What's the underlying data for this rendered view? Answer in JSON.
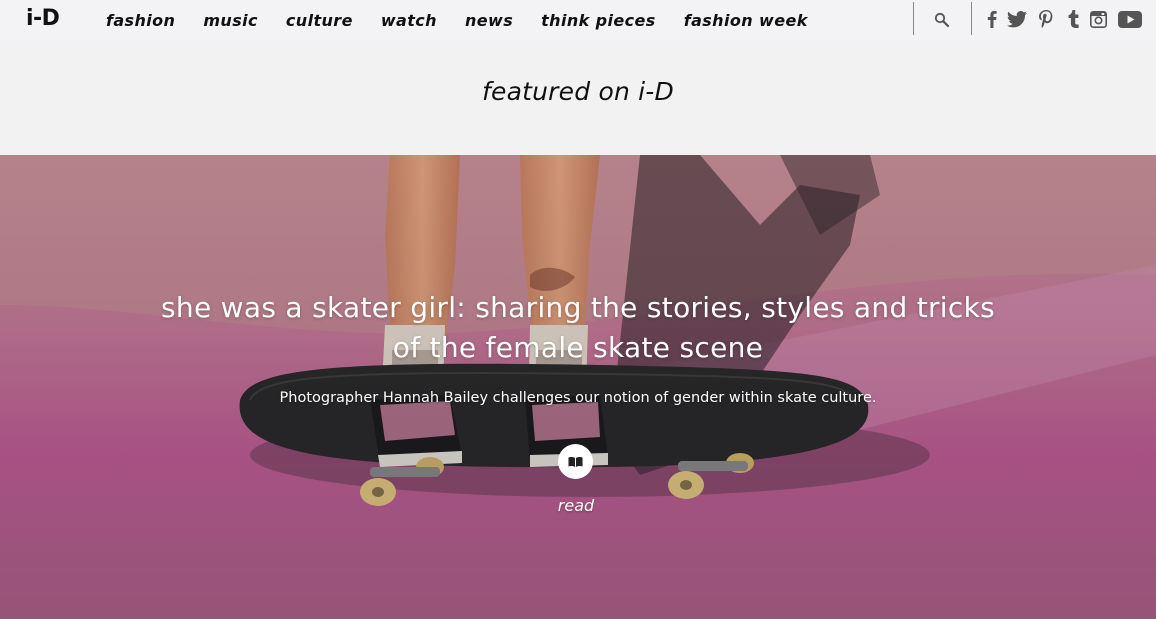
{
  "nav": {
    "logo": "i-D",
    "links": [
      "fashion",
      "music",
      "culture",
      "watch",
      "news",
      "think pieces",
      "fashion week"
    ],
    "search_icon": "search-icon",
    "social_icons": [
      "facebook-icon",
      "twitter-icon",
      "pinterest-icon",
      "tumblr-icon",
      "instagram-icon",
      "youtube-icon"
    ]
  },
  "featured": {
    "heading": "featured on i-D"
  },
  "hero": {
    "title": "she was a skater girl: sharing the stories, styles and tricks of the female skate scene",
    "subtitle": "Photographer Hannah Bailey challenges our notion of gender within skate culture.",
    "read_icon": "book-icon",
    "read_label": "read"
  },
  "colors": {
    "nav_bg": "#f3f3f5",
    "page_bg": "#f2f2f2",
    "text": "#111111",
    "hero_pink": "#c97fa0",
    "hero_text": "#ffffff"
  }
}
